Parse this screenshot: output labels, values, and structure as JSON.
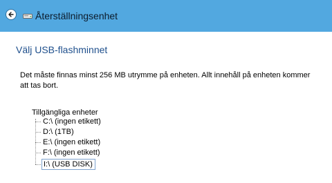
{
  "window": {
    "title": "Återställningsenhet"
  },
  "titlebar": {
    "back_icon": "back-arrow-icon",
    "drive_icon": "drive-icon",
    "color": "#52a8e0"
  },
  "main": {
    "heading": "Välj USB-flashminnet",
    "description": "Det måste finnas minst 256 MB utrymme på enheten. Allt innehåll på enheten kommer att tas bort.",
    "tree": {
      "label": "Tillgängliga enheter",
      "items": [
        {
          "label": "C:\\ (ingen etikett)",
          "selected": false
        },
        {
          "label": "D:\\ (1TB)",
          "selected": false
        },
        {
          "label": "E:\\ (ingen etikett)",
          "selected": false
        },
        {
          "label": "F:\\ (ingen etikett)",
          "selected": false
        },
        {
          "label": "I:\\ (USB DISK)",
          "selected": true
        }
      ]
    }
  }
}
